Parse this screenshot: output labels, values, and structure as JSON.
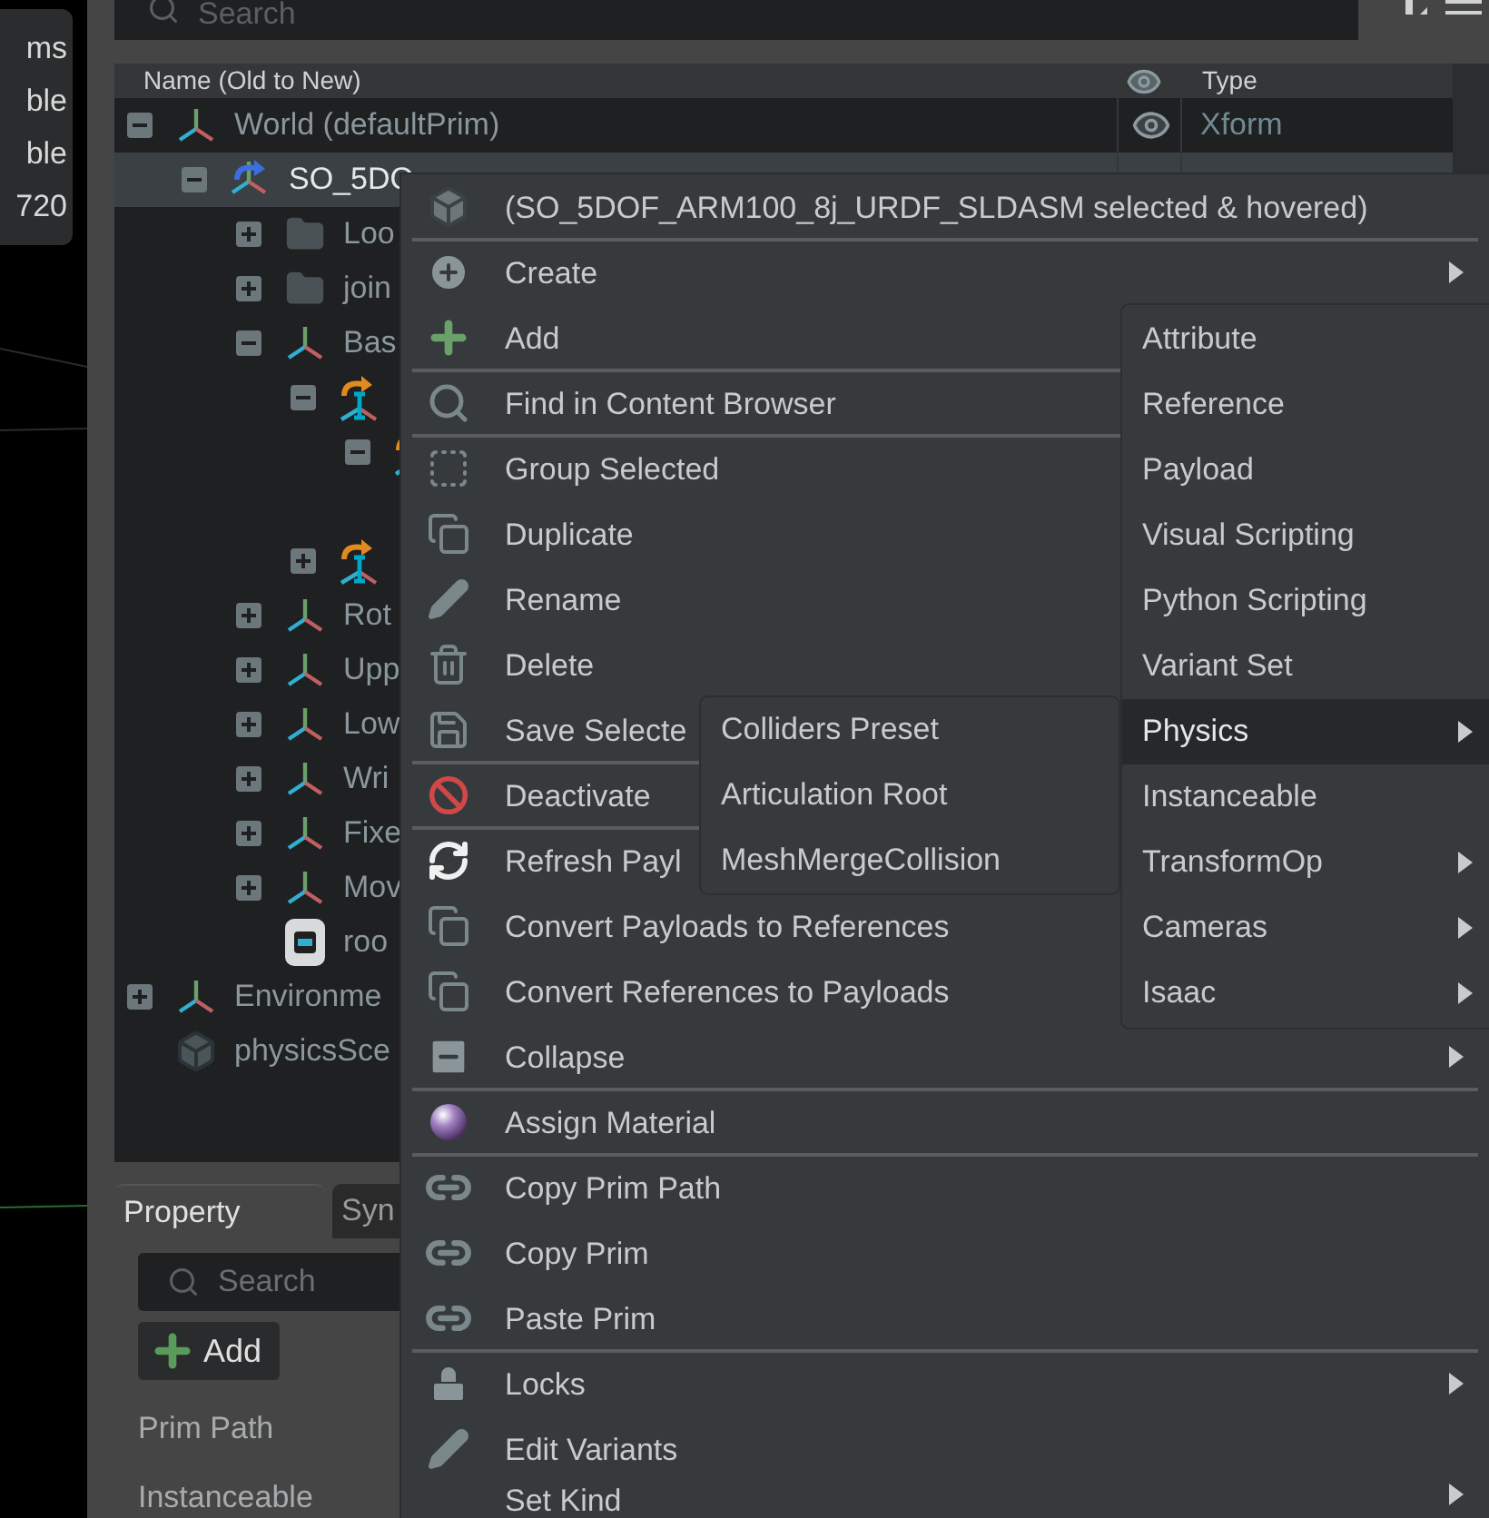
{
  "tooltip": {
    "lines": [
      "ms",
      "ble",
      "ble",
      "720"
    ]
  },
  "stage": {
    "search": {
      "placeholder": "Search"
    },
    "columns": {
      "name": "Name (Old to New)",
      "type": "Type"
    },
    "tree": [
      {
        "label": "World (defaultPrim)",
        "kind": "xform",
        "expanded": true,
        "selected": false,
        "type": "Xform",
        "children": [
          {
            "label": "SO_5DO",
            "kind": "xform-ref",
            "expanded": true,
            "selected": true,
            "children": [
              {
                "label": "Loo",
                "kind": "folder",
                "expanded": false,
                "selected": false
              },
              {
                "label": "join",
                "kind": "folder",
                "expanded": false,
                "selected": false
              },
              {
                "label": "Bas",
                "kind": "xform",
                "expanded": true,
                "selected": false,
                "children": [
                  {
                    "kind": "joint",
                    "expanded": true,
                    "selected": false,
                    "children": [
                      {
                        "kind": "joint",
                        "expanded": true,
                        "selected": false
                      }
                    ]
                  },
                  {
                    "kind": "joint",
                    "expanded": false,
                    "selected": false
                  }
                ]
              },
              {
                "label": "Rot",
                "kind": "xform",
                "expanded": false,
                "selected": false
              },
              {
                "label": "Upp",
                "kind": "xform",
                "expanded": false,
                "selected": false
              },
              {
                "label": "Low",
                "kind": "xform",
                "expanded": false,
                "selected": false
              },
              {
                "label": "Wri",
                "kind": "xform",
                "expanded": false,
                "selected": false
              },
              {
                "label": "Fixe",
                "kind": "xform",
                "expanded": false,
                "selected": false
              },
              {
                "label": "Mov",
                "kind": "xform",
                "expanded": false,
                "selected": false
              },
              {
                "label": "roo",
                "kind": "mesh",
                "selected": false
              }
            ]
          }
        ]
      },
      {
        "label": "Environme",
        "kind": "xform",
        "expanded": false,
        "selected": false
      },
      {
        "label": "physicsSce",
        "kind": "scene",
        "selected": false
      }
    ]
  },
  "property": {
    "tabs": [
      {
        "label": "Property",
        "selected": true
      },
      {
        "label": "Syn",
        "selected": false
      }
    ],
    "search": {
      "placeholder": "Search"
    },
    "add_button": "Add",
    "labels": [
      "Prim Path",
      "Instanceable"
    ]
  },
  "context_menu": {
    "items": [
      {
        "kind": "header",
        "label": "(SO_5DOF_ARM100_8j_URDF_SLDASM selected & hovered)"
      },
      {
        "kind": "separator"
      },
      {
        "kind": "item",
        "label": "Create",
        "submenu": true
      },
      {
        "kind": "item",
        "label": "Add",
        "submenu": false
      },
      {
        "kind": "separator"
      },
      {
        "kind": "item",
        "label": "Find in Content Browser",
        "submenu": false
      },
      {
        "kind": "separator"
      },
      {
        "kind": "item",
        "label": "Group Selected",
        "submenu": false
      },
      {
        "kind": "item",
        "label": "Duplicate",
        "submenu": false
      },
      {
        "kind": "item",
        "label": "Rename",
        "submenu": false
      },
      {
        "kind": "item",
        "label": "Delete",
        "submenu": false
      },
      {
        "kind": "item",
        "label": "Save Selecte",
        "submenu": false
      },
      {
        "kind": "separator"
      },
      {
        "kind": "item",
        "label": "Deactivate",
        "submenu": false
      },
      {
        "kind": "separator"
      },
      {
        "kind": "item",
        "label": "Refresh Payl",
        "submenu": false
      },
      {
        "kind": "item",
        "label": "Convert Payloads to References",
        "submenu": false
      },
      {
        "kind": "item",
        "label": "Convert References to Payloads",
        "submenu": false
      },
      {
        "kind": "item",
        "label": "Collapse",
        "submenu": true
      },
      {
        "kind": "separator"
      },
      {
        "kind": "item",
        "label": "Assign Material",
        "submenu": false
      },
      {
        "kind": "separator"
      },
      {
        "kind": "item",
        "label": "Copy Prim Path",
        "submenu": false
      },
      {
        "kind": "item",
        "label": "Copy Prim",
        "submenu": false
      },
      {
        "kind": "item",
        "label": "Paste Prim",
        "submenu": false
      },
      {
        "kind": "separator"
      },
      {
        "kind": "item",
        "label": "Locks",
        "submenu": true
      },
      {
        "kind": "item",
        "label": "Edit Variants",
        "submenu": false
      },
      {
        "kind": "item",
        "label": "Set Kind",
        "submenu": true
      }
    ]
  },
  "add_submenu": {
    "items": [
      {
        "label": "Attribute",
        "submenu": false,
        "selected": false
      },
      {
        "label": "Reference",
        "submenu": false,
        "selected": false
      },
      {
        "label": "Payload",
        "submenu": false,
        "selected": false
      },
      {
        "label": "Visual Scripting",
        "submenu": false,
        "selected": false
      },
      {
        "label": "Python Scripting",
        "submenu": false,
        "selected": false
      },
      {
        "label": "Variant Set",
        "submenu": false,
        "selected": false
      },
      {
        "label": "Physics",
        "submenu": true,
        "selected": true
      },
      {
        "label": "Instanceable",
        "submenu": false,
        "selected": false
      },
      {
        "label": "TransformOp",
        "submenu": true,
        "selected": false
      },
      {
        "label": "Cameras",
        "submenu": true,
        "selected": false
      },
      {
        "label": "Isaac",
        "submenu": true,
        "selected": false
      }
    ]
  },
  "physics_submenu": {
    "items": [
      {
        "label": "Colliders Preset",
        "selected": false
      },
      {
        "label": "Articulation Root",
        "selected": false
      },
      {
        "label": "MeshMergeCollision",
        "selected": false
      }
    ]
  }
}
